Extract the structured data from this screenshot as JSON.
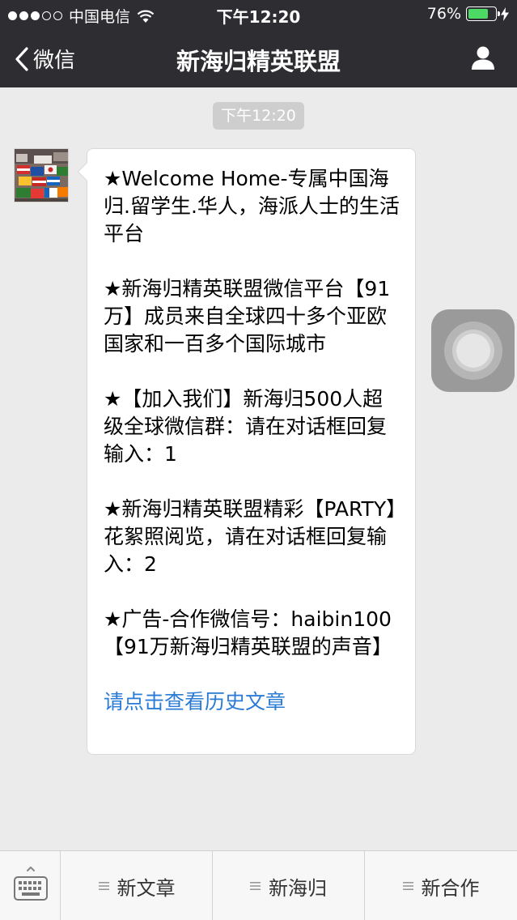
{
  "status_bar": {
    "carrier": "中国电信",
    "time": "下午12:20",
    "battery_percent": "76%",
    "battery_level": 0.76
  },
  "nav": {
    "back_label": "微信",
    "title": "新海归精英联盟"
  },
  "chat": {
    "timestamp": "下午12:20",
    "message": {
      "paragraphs": [
        "★Welcome Home-专属中国海归.留学生.华人，海派人士的生活平台",
        "★新海归精英联盟微信平台【91万】成员来自全球四十多个亚欧国家和一百多个国际城市",
        "★【加入我们】新海归500人超级全球微信群：请在对话框回复输入：1",
        "★新海归精英联盟精彩【PARTY】花絮照阅览，请在对话框回复输入：2",
        "★广告-合作微信号：haibin100 【91万新海归精英联盟的声音】"
      ],
      "link_text": "请点击查看历史文章"
    }
  },
  "bottom_menu": {
    "items": [
      {
        "label": "新文章"
      },
      {
        "label": "新海归"
      },
      {
        "label": "新合作"
      }
    ]
  },
  "colors": {
    "nav_background": "#2e2e32",
    "chat_background": "#ebebeb",
    "link": "#2a7bd6",
    "battery": "#4cd964"
  }
}
